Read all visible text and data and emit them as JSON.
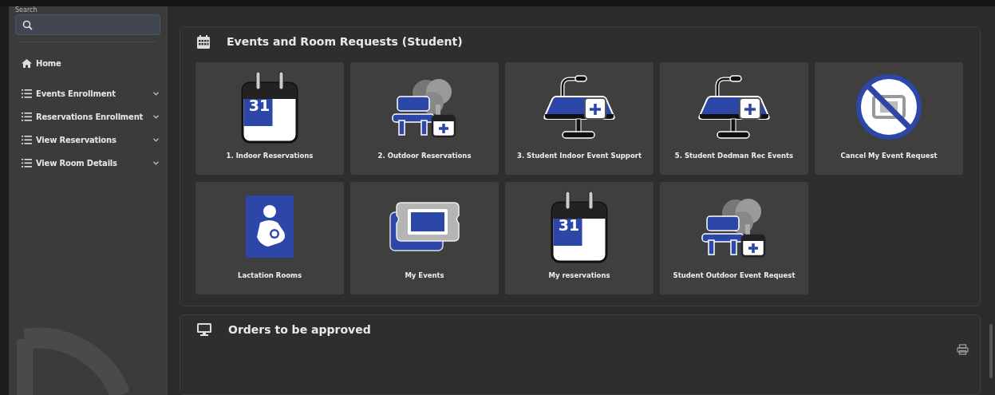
{
  "sidebar": {
    "search": {
      "label": "Search"
    },
    "items": [
      {
        "kind": "home",
        "label": "Home",
        "expandable": false
      },
      {
        "kind": "list",
        "label": "Events Enrollment",
        "expandable": true
      },
      {
        "kind": "list",
        "label": "Reservations Enrollment",
        "expandable": true
      },
      {
        "kind": "list",
        "label": "View Reservations",
        "expandable": true
      },
      {
        "kind": "list",
        "label": "View Room Details",
        "expandable": true
      }
    ]
  },
  "panels": [
    {
      "kind": "calendar",
      "title": "Events and Room Requests (Student)",
      "tiles": [
        {
          "kind": "calendar",
          "label": "1. Indoor Reservations",
          "day": "31"
        },
        {
          "kind": "bench",
          "label": "2. Outdoor Reservations"
        },
        {
          "kind": "podium",
          "label": "3. Student Indoor Event Support"
        },
        {
          "kind": "podium",
          "label": "5. Student Dedman Rec Events"
        },
        {
          "kind": "cancel",
          "label": "Cancel My Event Request"
        },
        {
          "kind": "lactation",
          "label": "Lactation Rooms"
        },
        {
          "kind": "ticket",
          "label": "My Events"
        },
        {
          "kind": "calendar",
          "label": "My reservations",
          "day": "31"
        },
        {
          "kind": "bench",
          "label": "Student Outdoor Event Request"
        }
      ]
    },
    {
      "kind": "monitor",
      "title": "Orders to be approved"
    }
  ]
}
